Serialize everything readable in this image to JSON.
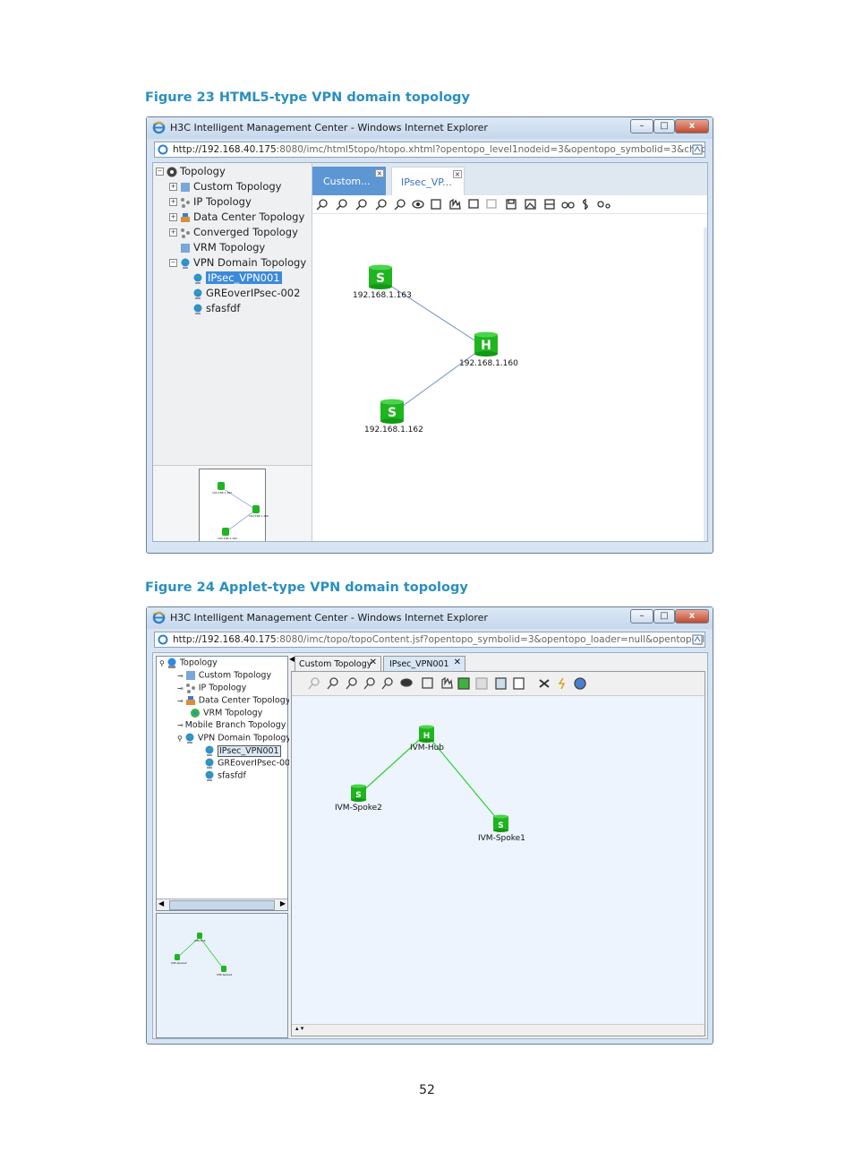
{
  "figure23": {
    "caption": "Figure 23 HTML5-type VPN domain topology",
    "window_title": "H3C Intelligent Management Center - Windows Internet Explorer",
    "address_host": "http://192.168.40.175",
    "address_path": ":8080/imc/html5topo/htopo.xhtml?opentopo_level1nodeid=3&opentopo_symbolid=3&checks",
    "tree": {
      "root": "Topology",
      "items": [
        "Custom Topology",
        "IP Topology",
        "Data Center Topology",
        "Converged Topology",
        "VRM Topology",
        "VPN Domain Topology"
      ],
      "children": [
        "IPsec_VPN001",
        "GREoverIPsec-002",
        "sfasfdf"
      ]
    },
    "tabs": [
      "Custom...",
      "IPsec_VP..."
    ],
    "nodes": [
      {
        "letter": "S",
        "label": "192.168.1.163"
      },
      {
        "letter": "H",
        "label": "192.168.1.160"
      },
      {
        "letter": "S",
        "label": "192.168.1.162"
      }
    ],
    "mini_labels": [
      "192.168.1.163",
      "192.168.1.160",
      "192.168.1.162"
    ]
  },
  "figure24": {
    "caption": "Figure 24 Applet-type VPN domain topology",
    "window_title": "H3C Intelligent Management Center - Windows Internet Explorer",
    "address_host": "http://192.168.40.175",
    "address_path": ":8080/imc/topo/topoContent.jsf?opentopo_symbolid=3&opentopo_loader=null&opentopo_le",
    "tree": {
      "root": "Topology",
      "items": [
        "Custom Topology",
        "IP Topology",
        "Data Center Topology",
        "VRM Topology",
        "Mobile Branch Topology",
        "VPN Domain Topology"
      ],
      "children": [
        "IPsec_VPN001",
        "GREoverIPsec-00",
        "sfasfdf"
      ]
    },
    "tabs": [
      "Custom Topology",
      "IPsec_VPN001"
    ],
    "nodes": [
      {
        "letter": "H",
        "label": "IVM-Hub"
      },
      {
        "letter": "S",
        "label": "IVM-Spoke2"
      },
      {
        "letter": "S",
        "label": "IVM-Spoke1"
      }
    ],
    "mini_labels": [
      "IVM-Hub",
      "IVM-Spoke2",
      "IVM-Spoke1"
    ]
  },
  "page_number": "52",
  "colors": {
    "caption": "#2a8fc1",
    "node_green": "#1fb51f",
    "link_blue": "#6f8fc8",
    "link_green": "#2fd02f"
  }
}
